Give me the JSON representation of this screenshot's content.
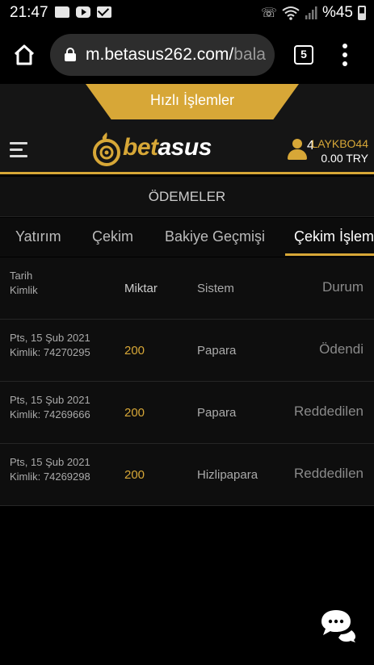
{
  "status_bar": {
    "time": "21:47",
    "battery": "%45",
    "left_icons": [
      "folder-icon",
      "youtube-icon",
      "mail-icon"
    ],
    "right_icons": [
      "wifi-call-icon",
      "wifi-icon",
      "signal-icon",
      "battery-icon"
    ]
  },
  "browser": {
    "url": "m.betasus262.com/",
    "url_fade": "bala",
    "tab_count": "5"
  },
  "quick_tab": {
    "label": "Hızlı İşlemler"
  },
  "header": {
    "logo_bet": "bet",
    "logo_asus": "asus",
    "notification_count": "4",
    "username": "LAYKBO44",
    "balance": "0.00 TRY"
  },
  "section": {
    "title": "ÖDEMELER"
  },
  "tabs": [
    {
      "label": "Yatırım",
      "active": false
    },
    {
      "label": "Çekim",
      "active": false
    },
    {
      "label": "Bakiye Geçmişi",
      "active": false
    },
    {
      "label": "Çekim İşlem",
      "active": true
    }
  ],
  "table": {
    "headers": {
      "date": "Tarih",
      "id": "Kimlik",
      "amount": "Miktar",
      "system": "Sistem",
      "status": "Durum"
    },
    "rows": [
      {
        "date": "Pts, 15 Şub 2021",
        "id": "Kimlik: 74270295",
        "amount": "200",
        "system": "Papara",
        "status": "Ödendi"
      },
      {
        "date": "Pts, 15 Şub 2021",
        "id": "Kimlik: 74269666",
        "amount": "200",
        "system": "Papara",
        "status": "Reddedilen"
      },
      {
        "date": "Pts, 15 Şub 2021",
        "id": "Kimlik: 74269298",
        "amount": "200",
        "system": "Hizlipapara",
        "status": "Reddedilen"
      }
    ]
  },
  "colors": {
    "accent": "#d7a737",
    "background": "#000000",
    "panel": "#151515"
  }
}
